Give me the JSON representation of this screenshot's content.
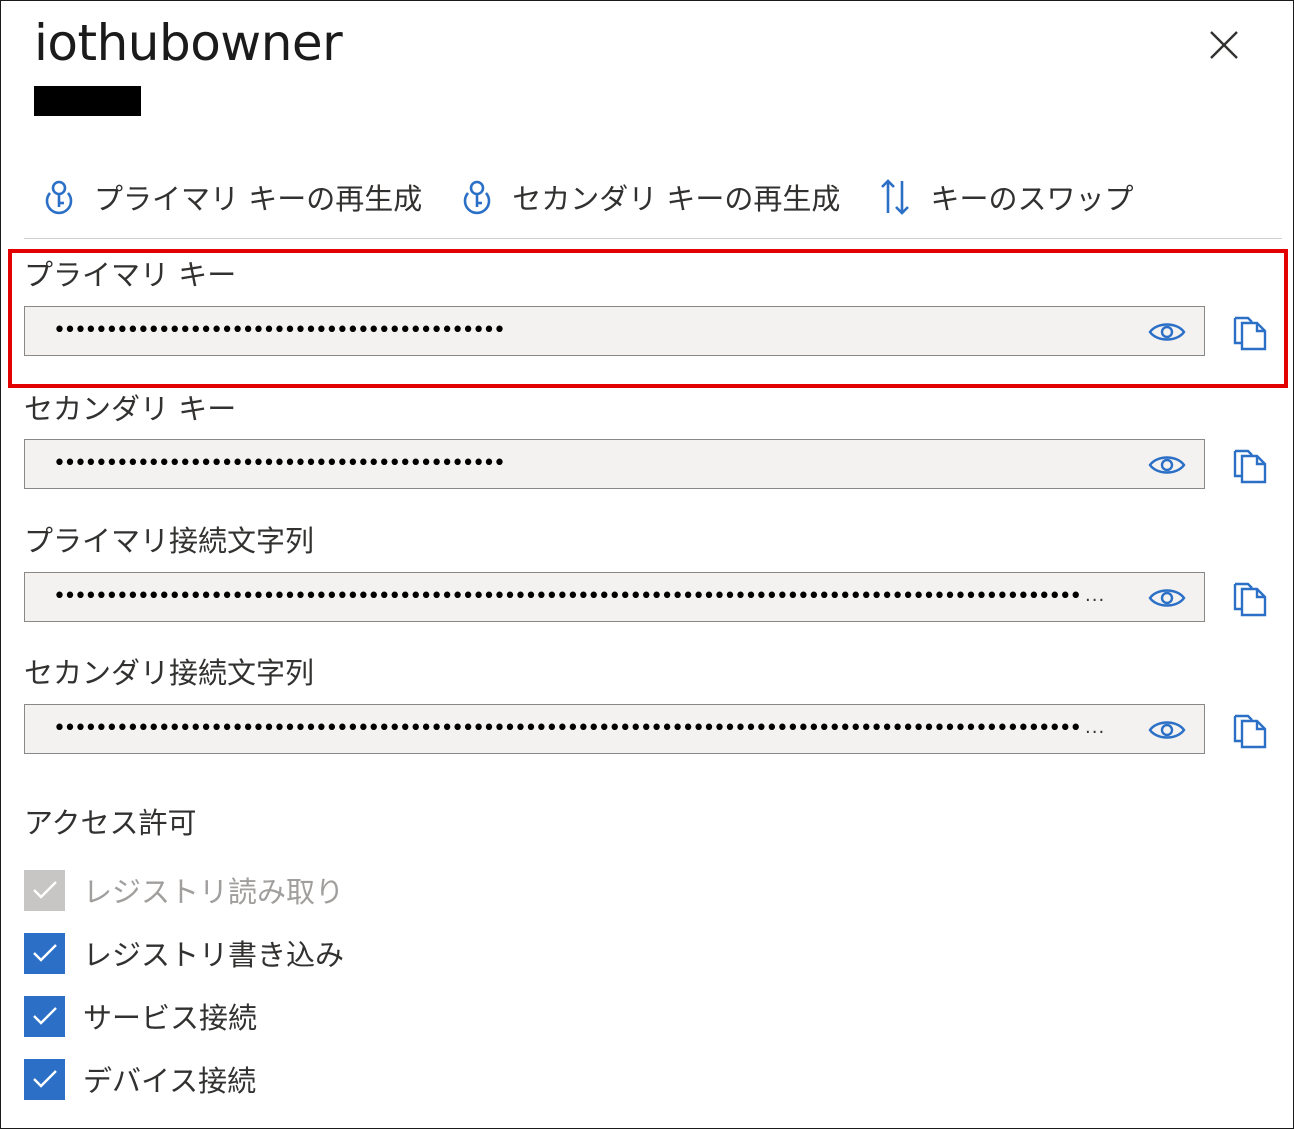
{
  "header": {
    "title": "iothubowner"
  },
  "toolbar": {
    "regen_primary": {
      "label": "プライマリ キーの再生成",
      "icon": "key-regenerate-icon"
    },
    "regen_secondary": {
      "label": "セカンダリ キーの再生成",
      "icon": "key-regenerate-icon"
    },
    "swap_keys": {
      "label": "キーのスワップ",
      "icon": "swap-arrows-icon"
    }
  },
  "fields": [
    {
      "label": "プライマリ キー",
      "value": "•••••••••••••••••••••••••••••••••••••••••••"
    },
    {
      "label": "セカンダリ キー",
      "value": "•••••••••••••••••••••••••••••••••••••••••••"
    },
    {
      "label": "プライマリ接続文字列",
      "value": "••••••••••••••••••••••••••••••••••••••••••••••••••••••••••••••••••••••••••••••••••••••••••••••••••••••••••••••",
      "ellipsis": "..."
    },
    {
      "label": "セカンダリ接続文字列",
      "value": "••••••••••••••••••••••••••••••••••••••••••••••••••••••••••••••••••••••••••••••••••••••••••••••••••••••••••••••",
      "ellipsis": "..."
    }
  ],
  "permissions": {
    "title": "アクセス許可",
    "items": [
      {
        "label": "レジストリ読み取り",
        "checked": true,
        "disabled": true
      },
      {
        "label": "レジストリ書き込み",
        "checked": true,
        "disabled": false
      },
      {
        "label": "サービス接続",
        "checked": true,
        "disabled": false
      },
      {
        "label": "デバイス接続",
        "checked": true,
        "disabled": false
      }
    ]
  },
  "colors": {
    "accent": "#2b70c6",
    "highlight_border": "#e20000",
    "disabled_checkbox": "#c8c6c4"
  }
}
